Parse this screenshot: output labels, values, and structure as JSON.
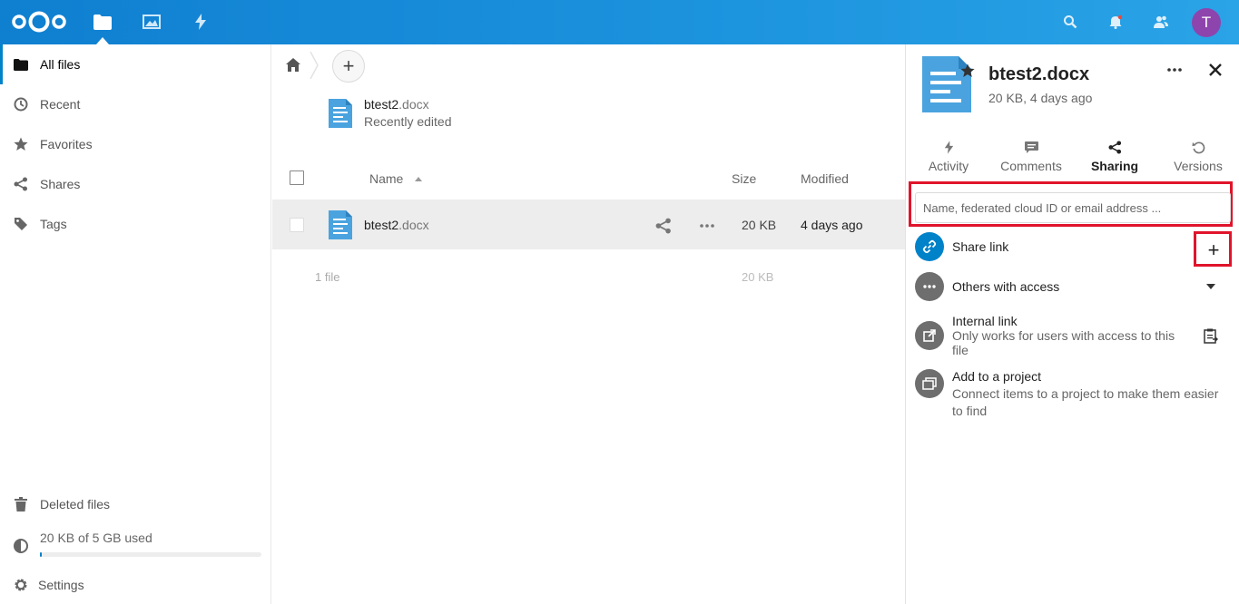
{
  "header": {
    "apps": [
      {
        "name": "files-icon",
        "active": true
      },
      {
        "name": "photos-icon",
        "active": false
      },
      {
        "name": "activity-icon",
        "active": false
      }
    ],
    "avatar_letter": "T",
    "colors": {
      "header": "#1d94de",
      "accent": "#0082c9",
      "avatar": "#8e44ad",
      "highlight": "#e0142b"
    }
  },
  "nav": {
    "items": [
      {
        "label": "All files",
        "icon": "folder-icon"
      },
      {
        "label": "Recent",
        "icon": "clock-icon"
      },
      {
        "label": "Favorites",
        "icon": "star-icon"
      },
      {
        "label": "Shares",
        "icon": "share-icon"
      },
      {
        "label": "Tags",
        "icon": "tag-icon"
      }
    ],
    "deleted": "Deleted files",
    "quota": "20 KB of 5 GB used",
    "quota_fraction": 0.01,
    "settings": "Settings"
  },
  "main": {
    "recent": {
      "name": "btest2",
      "ext": ".docx",
      "sub": "Recently edited"
    },
    "columns": {
      "name": "Name",
      "size": "Size",
      "modified": "Modified"
    },
    "rows": [
      {
        "name": "btest2",
        "ext": ".docx",
        "size": "20 KB",
        "modified": "4 days ago"
      }
    ],
    "summary": {
      "count": "1 file",
      "size": "20 KB"
    }
  },
  "sidebar": {
    "title": "btest2.docx",
    "subtitle": "20 KB, 4 days ago",
    "tabs": [
      {
        "label": "Activity",
        "icon": "activity-icon"
      },
      {
        "label": "Comments",
        "icon": "comment-icon"
      },
      {
        "label": "Sharing",
        "icon": "share-icon",
        "active": true
      },
      {
        "label": "Versions",
        "icon": "history-icon"
      }
    ],
    "share_placeholder": "Name, federated cloud ID or email address ...",
    "share_link": "Share link",
    "others": "Others with access",
    "internal_title": "Internal link",
    "internal_desc": "Only works for users with access to this file",
    "project_title": "Add to a project",
    "project_desc": "Connect items to a project to make them easier to find"
  }
}
